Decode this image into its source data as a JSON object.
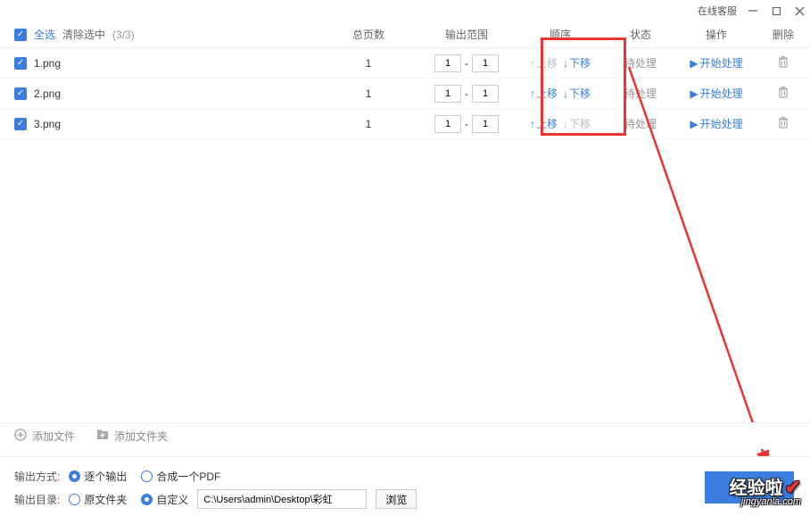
{
  "titlebar": {
    "online_service": "在线客服"
  },
  "header": {
    "select_all": "全选",
    "clear_selection": "清除选中",
    "count": "(3/3)",
    "col_pages": "总页数",
    "col_range": "输出范围",
    "col_order": "顺序",
    "col_status": "状态",
    "col_op": "操作",
    "col_del": "删除"
  },
  "order_labels": {
    "up": "上移",
    "down": "下移"
  },
  "op_labels": {
    "start": "开始处理"
  },
  "files": [
    {
      "name": "1.png",
      "pages": "1",
      "range_from": "1",
      "range_to": "1",
      "up_enabled": false,
      "down_enabled": true,
      "status": "待处理"
    },
    {
      "name": "2.png",
      "pages": "1",
      "range_from": "1",
      "range_to": "1",
      "up_enabled": true,
      "down_enabled": true,
      "status": "待处理"
    },
    {
      "name": "3.png",
      "pages": "1",
      "range_from": "1",
      "range_to": "1",
      "up_enabled": true,
      "down_enabled": false,
      "status": "待处理"
    }
  ],
  "add": {
    "add_file": "添加文件",
    "add_folder": "添加文件夹"
  },
  "settings": {
    "output_mode_label": "输出方式:",
    "mode_each": "逐个输出",
    "mode_merge": "合成一个PDF",
    "output_dir_label": "输出目录:",
    "dir_original": "原文件夹",
    "dir_custom": "自定义",
    "path": "C:\\Users\\admin\\Desktop\\彩虹",
    "browse": "浏览"
  },
  "watermark": {
    "main": "经验啦",
    "url": "jingyanla.com"
  }
}
